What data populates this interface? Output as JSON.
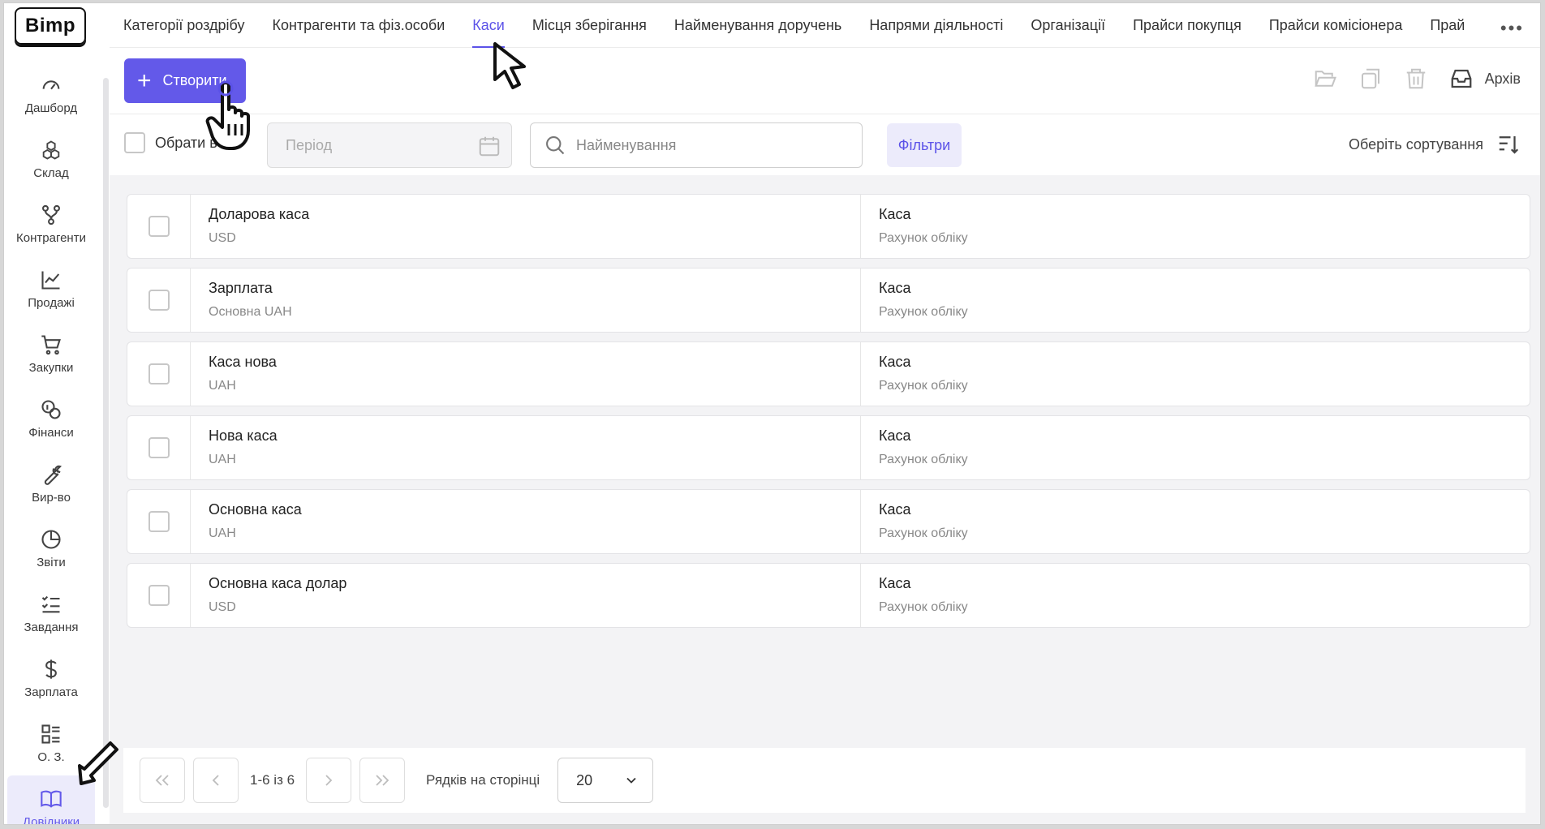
{
  "app": {
    "logo": "Bimp"
  },
  "sidebar": {
    "items": [
      {
        "label": "Дашборд",
        "icon": "gauge-icon"
      },
      {
        "label": "Склад",
        "icon": "boxes-icon"
      },
      {
        "label": "Контрагенти",
        "icon": "branches-icon"
      },
      {
        "label": "Продажі",
        "icon": "chart-line-icon"
      },
      {
        "label": "Закупки",
        "icon": "cart-icon"
      },
      {
        "label": "Фінанси",
        "icon": "coins-icon"
      },
      {
        "label": "Вир-во",
        "icon": "wrench-icon"
      },
      {
        "label": "Звіти",
        "icon": "pie-chart-icon"
      },
      {
        "label": "Завдання",
        "icon": "tasks-icon"
      },
      {
        "label": "Зарплата",
        "icon": "dollar-icon"
      },
      {
        "label": "О. З.",
        "icon": "assets-icon"
      },
      {
        "label": "Довідники",
        "icon": "book-icon",
        "active": true
      }
    ]
  },
  "tabs": [
    {
      "label": "Категорії роздрібу"
    },
    {
      "label": "Контрагенти та фіз.особи"
    },
    {
      "label": "Каси",
      "active": true
    },
    {
      "label": "Місця зберігання"
    },
    {
      "label": "Найменування доручень"
    },
    {
      "label": "Напрями діяльності"
    },
    {
      "label": "Організації"
    },
    {
      "label": "Прайси покупця"
    },
    {
      "label": "Прайси комісіонера"
    },
    {
      "label": "Прай"
    }
  ],
  "toolbar": {
    "create_label": "Створити",
    "archive_label": "Архів"
  },
  "filters": {
    "select_all_label": "Обрати всі",
    "period_placeholder": "Період",
    "search_placeholder": "Найменування",
    "filters_label": "Фільтри",
    "sort_label": "Оберіть сортування"
  },
  "rows": [
    {
      "name": "Доларова каса",
      "currency": "USD",
      "type": "Каса",
      "type_sub": "Рахунок обліку"
    },
    {
      "name": "Зарплата",
      "currency": "Основна UAH",
      "type": "Каса",
      "type_sub": "Рахунок обліку"
    },
    {
      "name": "Каса нова",
      "currency": "UAH",
      "type": "Каса",
      "type_sub": "Рахунок обліку"
    },
    {
      "name": "Нова каса",
      "currency": "UAH",
      "type": "Каса",
      "type_sub": "Рахунок обліку"
    },
    {
      "name": "Основна каса",
      "currency": "UAH",
      "type": "Каса",
      "type_sub": "Рахунок обліку"
    },
    {
      "name": "Основна каса долар",
      "currency": "USD",
      "type": "Каса",
      "type_sub": "Рахунок обліку"
    }
  ],
  "pagination": {
    "range": "1-6 із 6",
    "rows_label": "Рядків на сторінці",
    "rows_per_page": "20"
  },
  "colors": {
    "accent": "#6359e9",
    "accent_light": "#ecebfb"
  }
}
